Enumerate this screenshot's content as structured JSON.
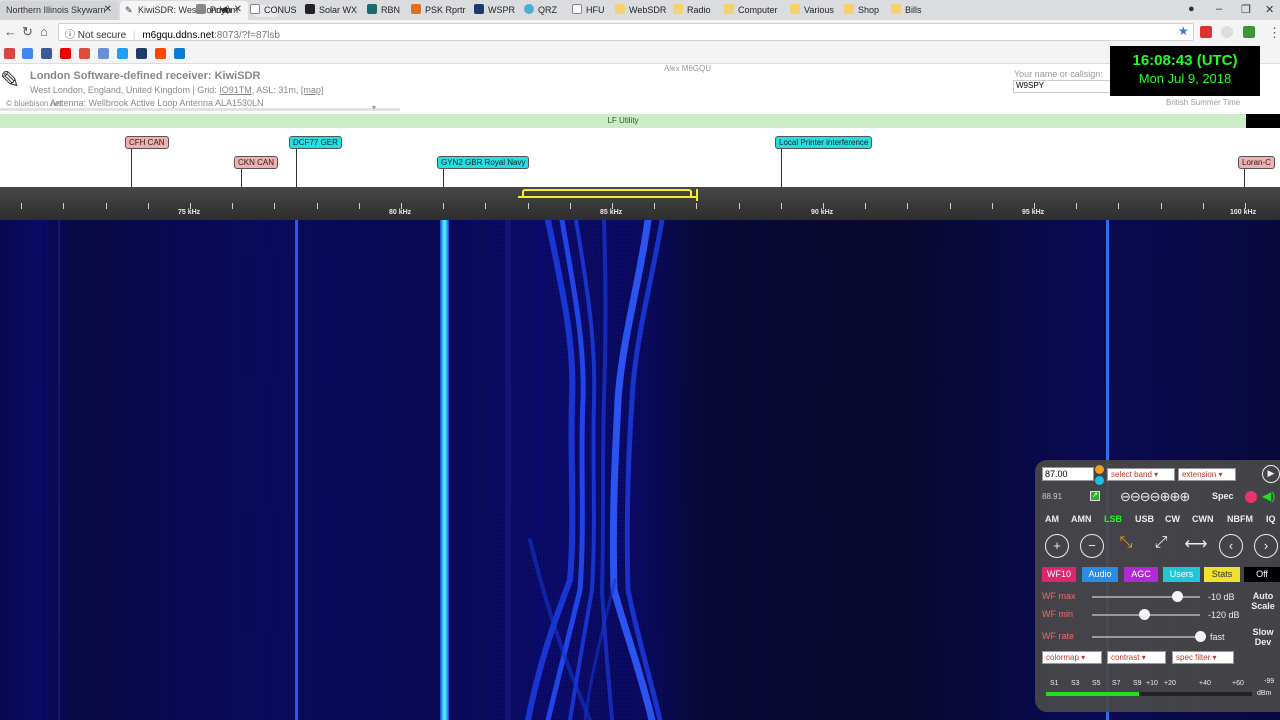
{
  "browser": {
    "tabs": [
      {
        "label": "Northern Illinois Skywarn"
      },
      {
        "label": "KiwiSDR: West London"
      }
    ],
    "url": {
      "secure_label": "Not secure",
      "host": "m6gqu.ddns.net",
      "path": ":8073/?f=87lsb"
    },
    "bookmarks": [
      "Priyom",
      "CONUS",
      "Solar WX",
      "RBN",
      "PSK Rprtr",
      "WSPR",
      "QRZ",
      "HFU",
      "WebSDR",
      "Radio",
      "Computer",
      "Various",
      "Shop",
      "Bills"
    ]
  },
  "header": {
    "title": "London Software-defined receiver: KiwiSDR",
    "location": "West London, England, United Kingdom | Grid: ",
    "grid": "IO91TM",
    "asl": ", ASL: 31m, ",
    "map_link": "[map]",
    "antenna": "Antenna: Wellbrook Active Loop Antenna ALA1530LN",
    "bluebison": "© bluebison.net",
    "owner": "Alex M6GQU",
    "name_label": "Your name or callsign:",
    "name_value": "W9SPY",
    "clock_time": "16:08:43 (UTC)",
    "clock_date": "Mon Jul 9, 2018",
    "timezone": "British Summer Time"
  },
  "band": {
    "name": "LF Utility"
  },
  "stations": [
    {
      "label": "CFH CAN",
      "kind": "pink"
    },
    {
      "label": "CKN CAN",
      "kind": "pink"
    },
    {
      "label": "DCF77 GER",
      "kind": "cyan"
    },
    {
      "label": "GYN2 GBR Royal Navy",
      "kind": "cyan"
    },
    {
      "label": "Local Printer interference",
      "kind": "cyan"
    },
    {
      "label": "Loran-C",
      "kind": "pink"
    }
  ],
  "scale": {
    "labels": [
      "75 kHz",
      "80 kHz",
      "85 kHz",
      "90 kHz",
      "95 kHz",
      "100 kHz"
    ]
  },
  "panel": {
    "freq": "87.00",
    "select_band": "select band",
    "extension": "extension",
    "passband_freq": "88.91",
    "spec_label": "Spec",
    "modes": [
      "AM",
      "AMN",
      "LSB",
      "USB",
      "CW",
      "CWN",
      "NBFM",
      "IQ"
    ],
    "active_mode": "LSB",
    "buttons": [
      {
        "label": "WF10",
        "color": "#e0246e"
      },
      {
        "label": "Audio",
        "color": "#2b8be6"
      },
      {
        "label": "AGC",
        "color": "#b12ad6"
      },
      {
        "label": "Users",
        "color": "#1ec7d9"
      },
      {
        "label": "Stats",
        "color": "#f0e030"
      },
      {
        "label": "Off",
        "color": "#000000"
      }
    ],
    "sliders": [
      {
        "label": "WF max",
        "value": "-10 dB",
        "level": 0.78
      },
      {
        "label": "WF min",
        "value": "-120 dB",
        "level": 0.46
      },
      {
        "label": "WF rate",
        "value": "fast",
        "level": 1.0
      }
    ],
    "auto_scale": "Auto Scale",
    "slow_dev": "Slow Dev",
    "colormap": "colormap",
    "contrast": "contrast",
    "spec_filter": "spec filter",
    "smeter_labels": [
      "S1",
      "S3",
      "S5",
      "S7",
      "S9",
      "+10",
      "+20",
      "+40",
      "+60",
      "-99"
    ],
    "smeter_unit": "dBm",
    "smeter_level": 0.45
  }
}
